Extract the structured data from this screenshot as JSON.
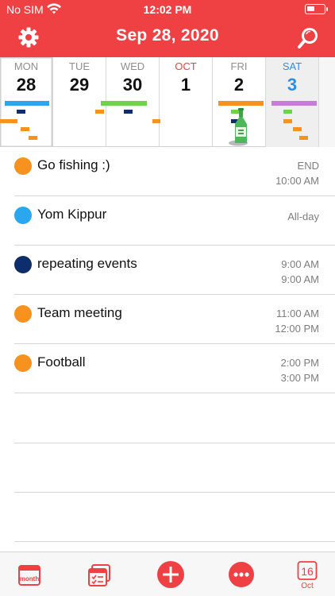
{
  "status": {
    "carrier": "No SIM",
    "time": "12:02 PM"
  },
  "header": {
    "title": "Sep 28, 2020"
  },
  "week": [
    {
      "dow": "MON",
      "num": "28"
    },
    {
      "dow": "TUE",
      "num": "29"
    },
    {
      "dow": "WED",
      "num": "30"
    },
    {
      "dow": "OCT",
      "num": "1"
    },
    {
      "dow": "FRI",
      "num": "2"
    },
    {
      "dow": "SAT",
      "num": "3"
    }
  ],
  "events": [
    {
      "title": "Go fishing :)",
      "time1": "END",
      "time2": "10:00 AM",
      "color": "#f7921e"
    },
    {
      "title": "Yom Kippur",
      "time1": "All-day",
      "time2": "",
      "color": "#2aa7ee"
    },
    {
      "title": "repeating events",
      "time1": "9:00 AM",
      "time2": "9:00 AM",
      "color": "#0d2d6b"
    },
    {
      "title": "Team meeting",
      "time1": "11:00 AM",
      "time2": "12:00 PM",
      "color": "#f7921e"
    },
    {
      "title": "Football",
      "time1": "2:00 PM",
      "time2": "3:00 PM",
      "color": "#f7921e"
    }
  ],
  "toolbar": {
    "month_label": "month",
    "today_num": "16",
    "today_month": "Oct"
  },
  "colors": {
    "accent": "#ef4044",
    "orange": "#f7921e",
    "blue": "#2aa7ee",
    "navy": "#0d2d6b",
    "green": "#6dd34a",
    "purple": "#c27fd4"
  }
}
